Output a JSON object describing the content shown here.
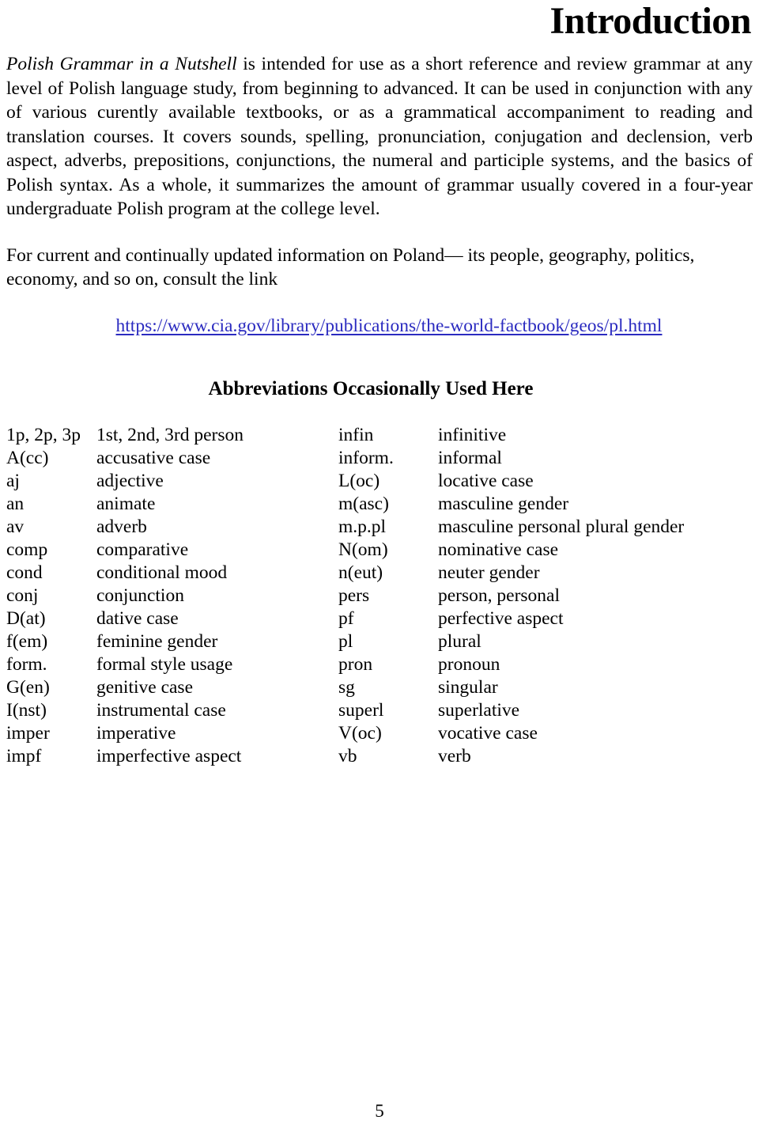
{
  "document": {
    "title": "Introduction",
    "page_number": "5"
  },
  "intro": {
    "paragraph_1_italic_lead": "Polish Grammar in a Nutshell",
    "paragraph_1_rest": " is intended for use as a short reference and review grammar at any level of Polish language study, from beginning to advanced. It can be used in conjunction with any of various curently available textbooks, or as a grammatical accompaniment to reading and translation courses.  It covers sounds, spelling, pronunciation, conjugation and declension, verb aspect, adverbs, prepositions, conjunctions, the numeral and participle systems, and the basics of Polish syntax. As a whole, it summarizes the amount of grammar usually covered in a four-year undergraduate Polish program at the college level.",
    "paragraph_2": "For current and continually updated information on Poland— its people, geography, politics, economy, and so on, consult  the link",
    "link_text": "https://www.cia.gov/library/publications/the-world-factbook/geos/pl.html",
    "link_color": "#2b2bc0"
  },
  "abbreviations": {
    "heading": "Abbreviations Occasionally Used Here",
    "rows": [
      {
        "abbr_left": "1p, 2p, 3p",
        "meaning_left": "1st, 2nd, 3rd person",
        "abbr_right": "infin",
        "meaning_right": "infinitive"
      },
      {
        "abbr_left": "A(cc)",
        "meaning_left": "accusative case",
        "abbr_right": "inform.",
        "meaning_right": "informal"
      },
      {
        "abbr_left": "aj",
        "meaning_left": "adjective",
        "abbr_right": "L(oc)",
        "meaning_right": "locative case"
      },
      {
        "abbr_left": "an",
        "meaning_left": "animate",
        "abbr_right": "m(asc)",
        "meaning_right": "masculine gender"
      },
      {
        "abbr_left": "av",
        "meaning_left": "adverb",
        "abbr_right": "m.p.pl",
        "meaning_right": "masculine personal plural gender"
      },
      {
        "abbr_left": "comp",
        "meaning_left": "comparative",
        "abbr_right": "N(om)",
        "meaning_right": "nominative case"
      },
      {
        "abbr_left": "cond",
        "meaning_left": "conditional mood",
        "abbr_right": "n(eut)",
        "meaning_right": "neuter gender"
      },
      {
        "abbr_left": "conj",
        "meaning_left": "conjunction",
        "abbr_right": "pers",
        "meaning_right": "person, personal"
      },
      {
        "abbr_left": "D(at)",
        "meaning_left": "dative case",
        "abbr_right": "pf",
        "meaning_right": "perfective aspect"
      },
      {
        "abbr_left": "f(em)",
        "meaning_left": "feminine gender",
        "abbr_right": "pl",
        "meaning_right": "plural"
      },
      {
        "abbr_left": "form.",
        "meaning_left": "formal style usage",
        "abbr_right": "pron",
        "meaning_right": "pronoun"
      },
      {
        "abbr_left": "G(en)",
        "meaning_left": "genitive case",
        "abbr_right": "sg",
        "meaning_right": "singular"
      },
      {
        "abbr_left": "I(nst)",
        "meaning_left": "instrumental case",
        "abbr_right": "superl",
        "meaning_right": "superlative"
      },
      {
        "abbr_left": "imper",
        "meaning_left": "imperative",
        "abbr_right": "V(oc)",
        "meaning_right": "vocative case"
      },
      {
        "abbr_left": "impf",
        "meaning_left": "imperfective aspect",
        "abbr_right": "vb",
        "meaning_right": "verb"
      }
    ]
  }
}
